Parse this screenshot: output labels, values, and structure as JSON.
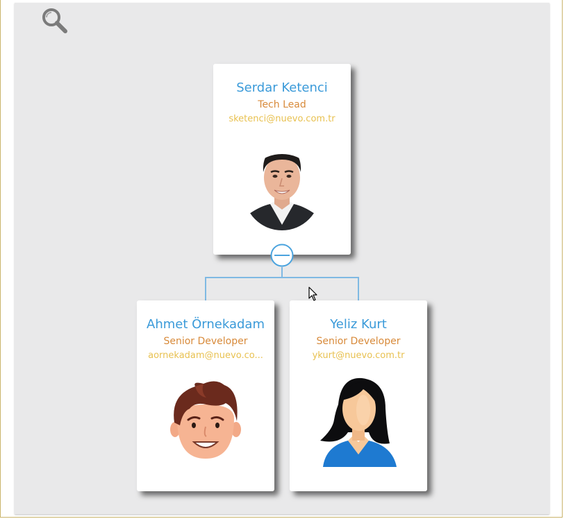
{
  "toolbar": {
    "search_icon": "search-icon"
  },
  "org_chart": {
    "root": {
      "name": "Serdar Ketenci",
      "title": "Tech Lead",
      "email": "sketenci@nuevo.com.tr",
      "avatar": "photo-man-avatar"
    },
    "toggle_icon": "minus-circle-icon",
    "children": [
      {
        "name": "Ahmet Örnekadam",
        "title": "Senior Developer",
        "email": "aornekadam@nuevo.co...",
        "avatar": "cartoon-man-avatar"
      },
      {
        "name": "Yeliz Kurt",
        "title": "Senior Developer",
        "email": "ykurt@nuevo.com.tr",
        "avatar": "cartoon-woman-avatar"
      }
    ]
  },
  "colors": {
    "name": "#3a9ad9",
    "title": "#d88a3a",
    "email": "#e8c150",
    "connector": "#7fb9e3",
    "background": "#e9e9ea"
  }
}
